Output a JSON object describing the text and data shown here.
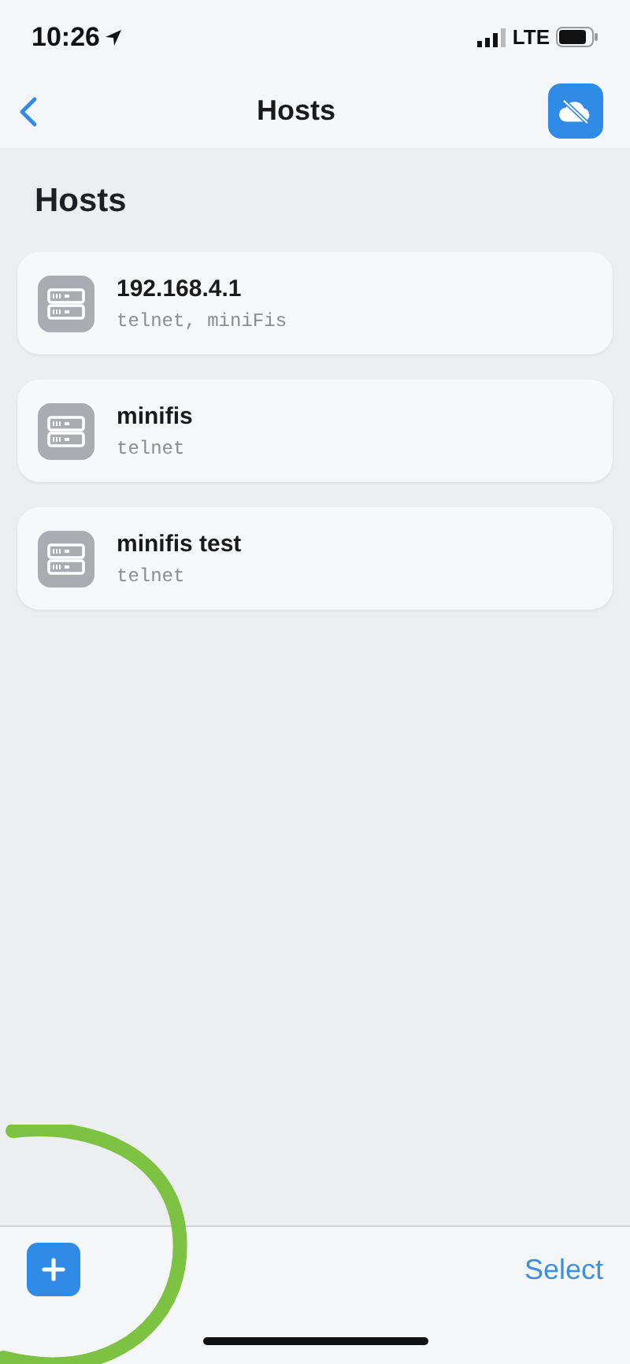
{
  "status_bar": {
    "time": "10:26",
    "network": "LTE"
  },
  "nav_bar": {
    "title": "Hosts"
  },
  "heading": "Hosts",
  "hosts": [
    {
      "name": "192.168.4.1",
      "protocols": "telnet, miniFis"
    },
    {
      "name": "minifis",
      "protocols": "telnet"
    },
    {
      "name": "minifis test",
      "protocols": "telnet"
    }
  ],
  "toolbar": {
    "select_label": "Select"
  }
}
